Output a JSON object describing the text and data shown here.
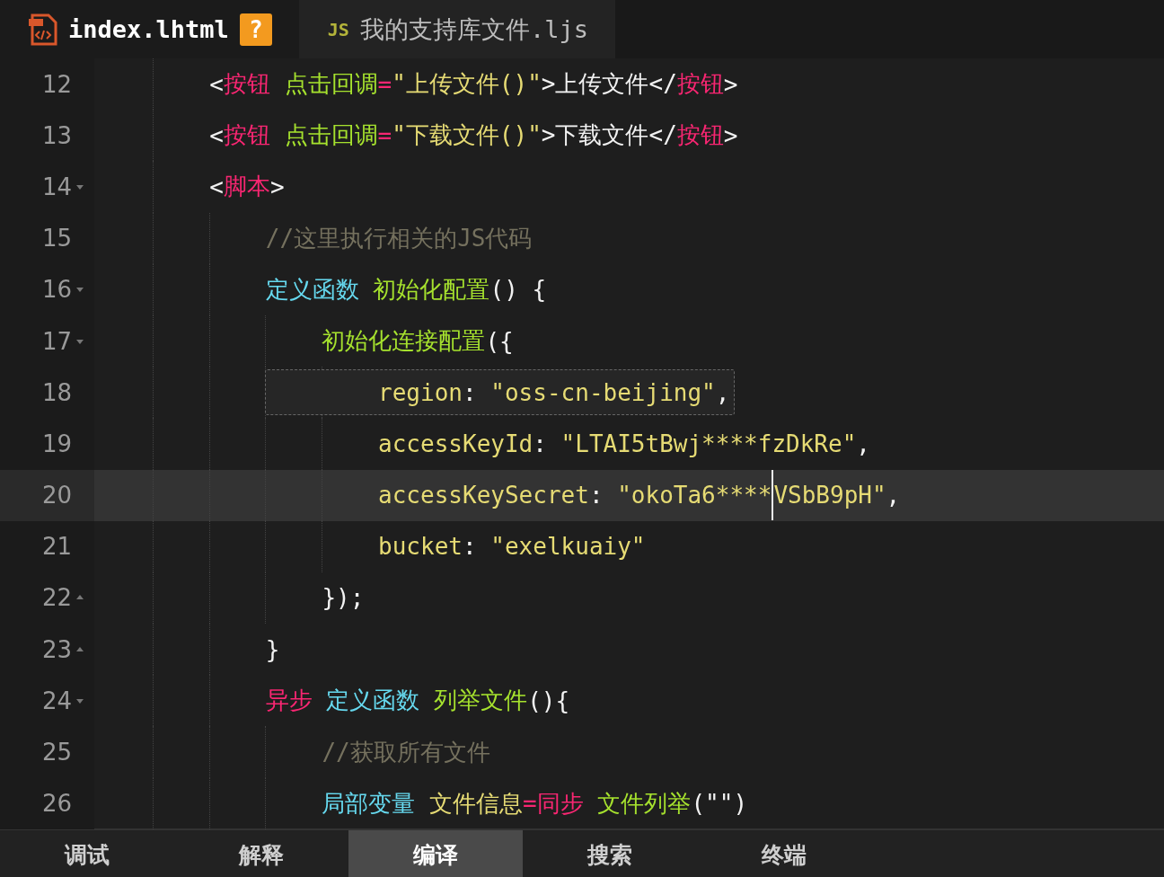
{
  "tabs": [
    {
      "kind": "html",
      "label": "index.lhtml",
      "badge": "?",
      "selected": true
    },
    {
      "kind": "js",
      "prefix": "JS",
      "label": "我的支持库文件.ljs",
      "selected": false
    }
  ],
  "lines": [
    {
      "number": "12",
      "kind": "plain",
      "current": false,
      "boxed": false,
      "tokens": [
        {
          "kind": "punct",
          "text": "        <"
        },
        {
          "kind": "tag",
          "text": "按钮"
        },
        {
          "kind": "attr",
          "text": " 点击回调"
        },
        {
          "kind": "op",
          "text": "="
        },
        {
          "kind": "string",
          "text": "\"上传文件()\""
        },
        {
          "kind": "punct",
          "text": ">上传文件</"
        },
        {
          "kind": "tag",
          "text": "按钮"
        },
        {
          "kind": "punct",
          "text": ">"
        }
      ]
    },
    {
      "number": "13",
      "kind": "plain",
      "current": false,
      "boxed": false,
      "tokens": [
        {
          "kind": "punct",
          "text": "        <"
        },
        {
          "kind": "tag",
          "text": "按钮"
        },
        {
          "kind": "attr",
          "text": " 点击回调"
        },
        {
          "kind": "op",
          "text": "="
        },
        {
          "kind": "string",
          "text": "\"下载文件()\""
        },
        {
          "kind": "punct",
          "text": ">下载文件</"
        },
        {
          "kind": "tag",
          "text": "按钮"
        },
        {
          "kind": "punct",
          "text": ">"
        }
      ]
    },
    {
      "number": "14",
      "kind": "fold-start",
      "current": false,
      "boxed": false,
      "tokens": [
        {
          "kind": "punct",
          "text": "        <"
        },
        {
          "kind": "tag",
          "text": "脚本"
        },
        {
          "kind": "punct",
          "text": ">"
        }
      ]
    },
    {
      "number": "15",
      "kind": "plain",
      "current": false,
      "boxed": false,
      "tokens": [
        {
          "kind": "comment",
          "text": "            //这里执行相关的JS代码"
        }
      ]
    },
    {
      "number": "16",
      "kind": "fold-start",
      "current": false,
      "boxed": false,
      "tokens": [
        {
          "kind": "keyword",
          "text": "            定义函数"
        },
        {
          "kind": "func",
          "text": " 初始化配置"
        },
        {
          "kind": "punct",
          "text": "() {"
        }
      ]
    },
    {
      "number": "17",
      "kind": "fold-start",
      "current": false,
      "boxed": false,
      "tokens": [
        {
          "kind": "func",
          "text": "                初始化连接配置"
        },
        {
          "kind": "punct",
          "text": "({"
        }
      ]
    },
    {
      "number": "18",
      "kind": "plain",
      "current": false,
      "boxed": true,
      "tokens": [
        {
          "kind": "key",
          "text": "                    region"
        },
        {
          "kind": "punct",
          "text": ": "
        },
        {
          "kind": "string",
          "text": "\"oss-cn-beijing\""
        },
        {
          "kind": "punct",
          "text": ","
        }
      ]
    },
    {
      "number": "19",
      "kind": "plain",
      "current": false,
      "boxed": false,
      "tokens": [
        {
          "kind": "key",
          "text": "                    accessKeyId"
        },
        {
          "kind": "punct",
          "text": ": "
        },
        {
          "kind": "string",
          "text": "\"LTAI5tBwj****fzDkRe\""
        },
        {
          "kind": "punct",
          "text": ","
        }
      ]
    },
    {
      "number": "20",
      "kind": "plain",
      "current": true,
      "boxed": false,
      "tokens": [
        {
          "kind": "key",
          "text": "                    accessKeySecret"
        },
        {
          "kind": "punct",
          "text": ": "
        },
        {
          "kind": "string",
          "text": "\"okoTa6****",
          "caret": true
        },
        {
          "kind": "string",
          "text": "VSbB9pH\""
        },
        {
          "kind": "punct",
          "text": ","
        }
      ]
    },
    {
      "number": "21",
      "kind": "plain",
      "current": false,
      "boxed": false,
      "tokens": [
        {
          "kind": "key",
          "text": "                    bucket"
        },
        {
          "kind": "punct",
          "text": ": "
        },
        {
          "kind": "string",
          "text": "\"exelkuaiy\""
        }
      ]
    },
    {
      "number": "22",
      "kind": "fold-end",
      "current": false,
      "boxed": false,
      "tokens": [
        {
          "kind": "punct",
          "text": "                });"
        }
      ]
    },
    {
      "number": "23",
      "kind": "fold-end",
      "current": false,
      "boxed": false,
      "tokens": [
        {
          "kind": "punct",
          "text": "            }"
        }
      ]
    },
    {
      "number": "24",
      "kind": "fold-start",
      "current": false,
      "boxed": false,
      "tokens": [
        {
          "kind": "storage",
          "text": "            异步"
        },
        {
          "kind": "keyword",
          "text": " 定义函数"
        },
        {
          "kind": "func",
          "text": " 列举文件"
        },
        {
          "kind": "punct",
          "text": "(){"
        }
      ]
    },
    {
      "number": "25",
      "kind": "plain",
      "current": false,
      "boxed": false,
      "tokens": [
        {
          "kind": "comment",
          "text": "                //获取所有文件"
        }
      ]
    },
    {
      "number": "26",
      "kind": "plain",
      "current": false,
      "boxed": false,
      "tokens": [
        {
          "kind": "keyword",
          "text": "                局部变量"
        },
        {
          "kind": "var",
          "text": " 文件信息"
        },
        {
          "kind": "op",
          "text": "="
        },
        {
          "kind": "storage",
          "text": "同步"
        },
        {
          "kind": "func",
          "text": " 文件列举"
        },
        {
          "kind": "punct",
          "text": "(\"\")"
        }
      ]
    }
  ],
  "bottom_tabs": [
    {
      "label": "调试",
      "selected": false
    },
    {
      "label": "解释",
      "selected": false
    },
    {
      "label": "编译",
      "selected": true
    },
    {
      "label": "搜索",
      "selected": false
    },
    {
      "label": "终端",
      "selected": false
    }
  ]
}
